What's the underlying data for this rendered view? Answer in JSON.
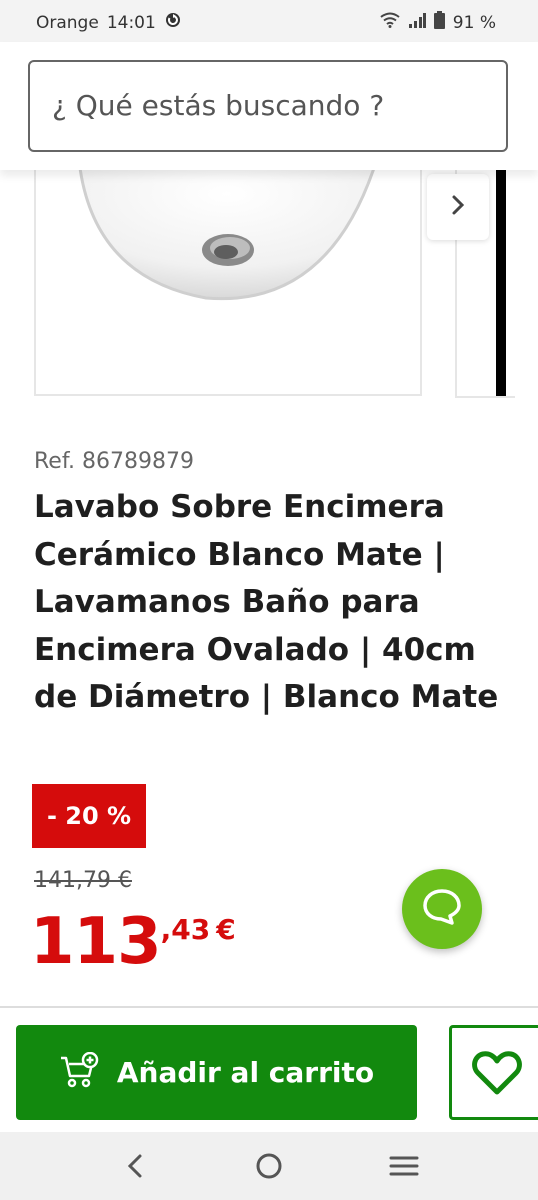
{
  "status_bar": {
    "carrier": "Orange",
    "time": "14:01",
    "battery": "91 %"
  },
  "search": {
    "placeholder": "¿ Qué estás buscando ?"
  },
  "product": {
    "ref": "Ref. 86789879",
    "title": "Lavabo Sobre Encimera Cerámico Blanco Mate | Lavamanos Baño para Encimera Ovalado | 40cm de Diámetro | Blanco Mate",
    "discount_badge": "- 20 %",
    "old_price": "141,79 €",
    "price_integer": "113",
    "price_decimal": ",43",
    "price_currency": "€"
  },
  "actions": {
    "add_to_cart": "Añadir al carrito"
  },
  "icons": {
    "next": "chevron-right-icon",
    "chat": "chat-bubble-icon",
    "cart": "cart-add-icon",
    "favorite": "heart-icon",
    "nav_back": "back-icon",
    "nav_home": "home-icon",
    "nav_recent": "menu-icon"
  },
  "colors": {
    "accent_green": "#12890e",
    "discount_red": "#d50c0c",
    "chat_green": "#6bbf1c"
  }
}
